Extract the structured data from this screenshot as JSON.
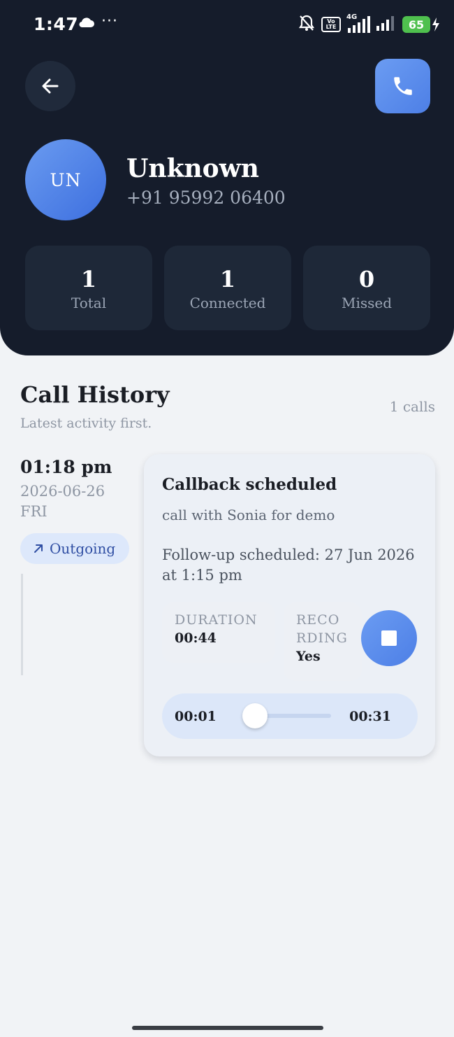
{
  "status_bar": {
    "time": "1:47",
    "dots": "···",
    "network_label": "4G",
    "volte_top": "Vo",
    "volte_bottom": "LTE",
    "battery": "65"
  },
  "contact": {
    "initials": "UN",
    "name": "Unknown",
    "phone": "+91 95992 06400"
  },
  "stats": [
    {
      "value": "1",
      "label": "Total"
    },
    {
      "value": "1",
      "label": "Connected"
    },
    {
      "value": "0",
      "label": "Missed"
    }
  ],
  "history": {
    "title": "Call History",
    "subtitle": "Latest activity first.",
    "count": "1 calls"
  },
  "entry": {
    "time": "01:18 pm",
    "date": "2026-06-26",
    "day": "FRI",
    "direction": "Outgoing",
    "card_title": "Callback scheduled",
    "note": "call with Sonia for demo",
    "followup": "Follow-up scheduled: 27 Jun 2026 at 1:15 pm",
    "duration_label": "DURATION",
    "duration_value": "00:44",
    "recording_label_1": "RECO",
    "recording_label_2": "RDING",
    "recording_value": "Yes",
    "player_current": "00:01",
    "player_total": "00:31",
    "player_progress": 0.03
  },
  "colors": {
    "header_bg": "#151c2b",
    "accent": "#5b8def",
    "page_bg": "#f1f3f6"
  }
}
